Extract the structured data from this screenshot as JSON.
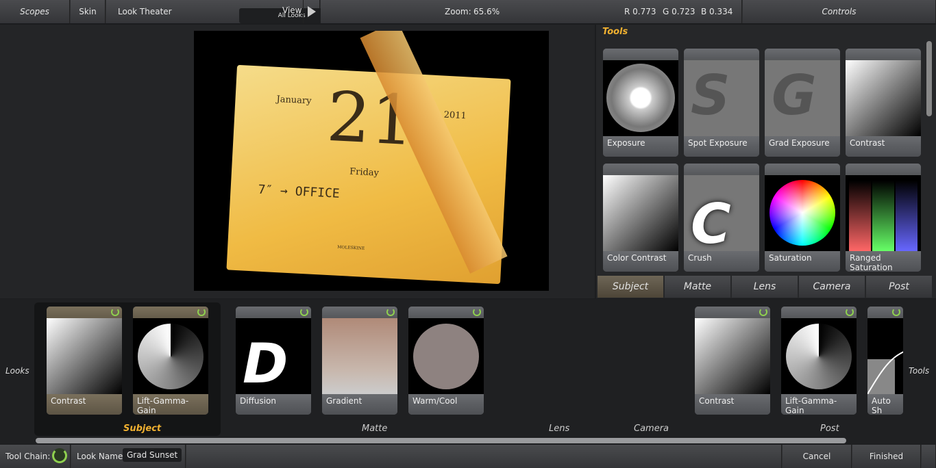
{
  "toolbar": {
    "scopes": "Scopes",
    "skin": "Skin",
    "look_theater": "Look Theater",
    "looks_filter": "All Looks",
    "view": "View",
    "zoom_label": "Zoom:",
    "zoom_value": "65.6%",
    "rgb": {
      "r": "R 0.773",
      "g": "G 0.723",
      "b": "B 0.334"
    },
    "controls": "Controls"
  },
  "photo": {
    "month": "January",
    "day": "21",
    "year": "2011",
    "weekday": "Friday",
    "note": "7″ → OFFICE",
    "brand": "MOLESKINE"
  },
  "tools": {
    "title": "Tools",
    "items": [
      "Exposure",
      "Spot Exposure",
      "Grad Exposure",
      "Contrast",
      "Color Contrast",
      "Crush",
      "Saturation",
      "Ranged Saturation"
    ],
    "tabs": [
      "Subject",
      "Matte",
      "Lens",
      "Camera",
      "Post"
    ],
    "active_tab": "Subject"
  },
  "looks": {
    "left_label": "Looks",
    "right_label": "Tools",
    "chain": [
      "Contrast",
      "Lift-Gamma-Gain",
      "Diffusion",
      "Gradient",
      "Warm/Cool",
      "Contrast",
      "Lift-Gamma-Gain",
      "Auto Sh"
    ],
    "sections": [
      "Subject",
      "Matte",
      "Lens",
      "Camera",
      "Post"
    ]
  },
  "footer": {
    "tool_chain": "Tool Chain:",
    "look_name_label": "Look Name:",
    "look_name": "Grad Sunset",
    "cancel": "Cancel",
    "finished": "Finished"
  },
  "colors": {
    "accent": "#f0b030",
    "power": "#8fd14f"
  }
}
